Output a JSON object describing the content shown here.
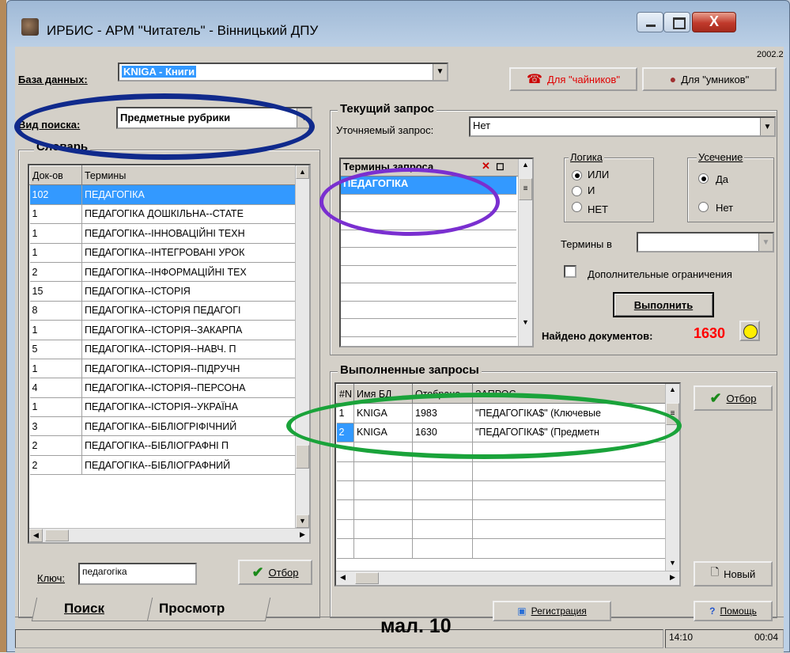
{
  "window": {
    "title": "ИРБИС - АРМ \"Читатель\" - Вінницький ДПУ",
    "version": "2002.2",
    "close_glyph": "X"
  },
  "top": {
    "db_label": "База данных:",
    "db_value": "KNIGA - Книги",
    "search_type_label": "Вид поиска:",
    "search_type_value": "Предметные рубрики",
    "btn_dummies": "Для \"чайников\"",
    "btn_smart": "Для \"умников\""
  },
  "dictionary": {
    "title": "Словарь",
    "col_docs": "Док-ов",
    "col_terms": "Термины",
    "rows": [
      {
        "n": "102",
        "term": "ПЕДАГОГІКА"
      },
      {
        "n": "1",
        "term": "ПЕДАГОГІКА ДОШКІЛЬНА--СТАТЕ"
      },
      {
        "n": "1",
        "term": "ПЕДАГОГІКА--ІННОВАЦІЙНІ ТЕХН"
      },
      {
        "n": "1",
        "term": "ПЕДАГОГІКА--ІНТЕГРОВАНІ УРОК"
      },
      {
        "n": "2",
        "term": "ПЕДАГОГІКА--ІНФОРМАЦІЙНІ ТЕХ"
      },
      {
        "n": "15",
        "term": "ПЕДАГОГІКА--ІСТОРІЯ"
      },
      {
        "n": "8",
        "term": "ПЕДАГОГІКА--ІСТОРІЯ ПЕДАГОГІ"
      },
      {
        "n": "1",
        "term": "ПЕДАГОГІКА--ІСТОРІЯ--ЗАКАРПА"
      },
      {
        "n": "5",
        "term": "ПЕДАГОГІКА--ІСТОРІЯ--НАВЧ. П"
      },
      {
        "n": "1",
        "term": "ПЕДАГОГІКА--ІСТОРІЯ--ПІДРУЧН"
      },
      {
        "n": "4",
        "term": "ПЕДАГОГІКА--ІСТОРІЯ--ПЕРСОНА"
      },
      {
        "n": "1",
        "term": "ПЕДАГОГІКА--ІСТОРІЯ--УКРАЇНА"
      },
      {
        "n": "3",
        "term": "ПЕДАГОГІКА--БІБЛІОГРІФІЧНИЙ"
      },
      {
        "n": "2",
        "term": "ПЕДАГОГІКА--БІБЛІОГРАФНІ П"
      },
      {
        "n": "2",
        "term": "ПЕДАГОГІКА--БІБЛІОГРАФНИЙ"
      }
    ],
    "key_label": "Ключ:",
    "key_value": "педагогіка",
    "select_button": "Отбор"
  },
  "current_query": {
    "title": "Текущий запрос",
    "refine_label": "Уточняемый запрос:",
    "refine_value": "Нет",
    "terms_header": "Термины запроса",
    "terms": [
      "ПЕДАГОГІКА"
    ],
    "logic_title": "Логика",
    "logic_options": [
      "ИЛИ",
      "И",
      "НЕТ"
    ],
    "truncation_title": "Усечение",
    "truncation_options": [
      "Да",
      "Нет"
    ],
    "terms_in_label": "Термины в",
    "extra_limits_label": "Дополнительные ограничения",
    "execute_button": "Выполнить",
    "found_label": "Найдено документов:",
    "found_count": "1630"
  },
  "executed_queries": {
    "title": "Выполненные запросы",
    "cols": [
      "#N",
      "Имя БД",
      "Отобрано",
      "ЗАПРОС"
    ],
    "rows": [
      {
        "n": "1",
        "db": "KNIGA",
        "count": "1983",
        "query": "\"ПЕДАГОГІКА$\" (Ключевые"
      },
      {
        "n": "2",
        "db": "KNIGA",
        "count": "1630",
        "query": "\"ПЕДАГОГІКА$\" (Предметн"
      }
    ],
    "select_button": "Отбор",
    "new_button": "Новый"
  },
  "bottom": {
    "tab_search": "Поиск",
    "tab_view": "Просмотр",
    "register_button": "Регистрация",
    "help_button": "Помощь",
    "caption": "мал. 10",
    "time1": "14:10",
    "time2": "00:04"
  },
  "colors": {
    "selection": "#3399ff",
    "found_count": "#ff0000",
    "annotation_blue": "#102a8c",
    "annotation_purple": "#7a2fd0",
    "annotation_green": "#1aa33a"
  }
}
